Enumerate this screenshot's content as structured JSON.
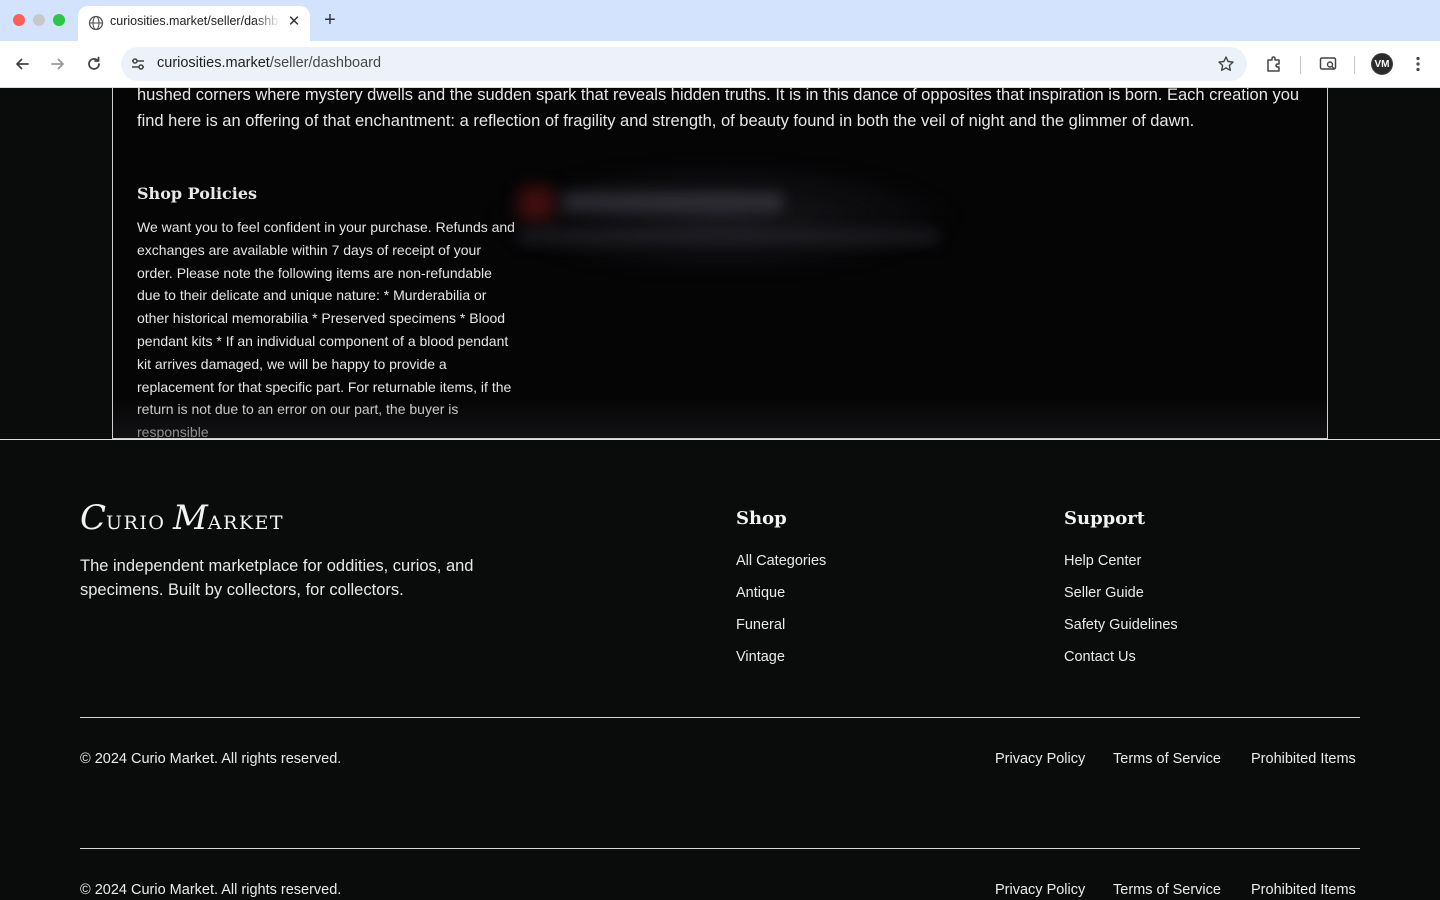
{
  "browser": {
    "tab_title": "curiosities.market/seller/dashboard",
    "url_host": "curiosities.market",
    "url_path": "/seller/dashboard",
    "icons": [
      "globe-icon",
      "close-icon",
      "plus-icon",
      "back-icon",
      "forward-icon",
      "reload-icon",
      "site-info-icon",
      "star-icon",
      "extensions-icon",
      "cast-icon",
      "profile-avatar",
      "menu-icon"
    ],
    "avatar_initials": "VM"
  },
  "shop": {
    "about_text": "hushed corners where mystery dwells and the sudden spark that reveals hidden truths. It is in this dance of opposites that inspiration is born. Each creation you find here is an offering of that enchantment: a reflection of fragility and strength, of beauty found in both the veil of night and the glimmer of dawn.",
    "policies_title": "Shop Policies",
    "policies_text": "We want you to feel confident in your purchase. Refunds and exchanges are available within 7 days of receipt of your order. Please note the following items are non-refundable due to their delicate and unique nature: * Murderabilia or other historical memorabilia * Preserved specimens * Blood pendant kits * If an individual component of a blood pendant kit arrives damaged, we will be happy to provide a replacement for that specific part. For returnable items, if the return is not due to an error on our part, the buyer is responsible"
  },
  "footer": {
    "logo_first_initial": "C",
    "logo_first_rest": "URIO ",
    "logo_second_initial": "M",
    "logo_second_rest": "ARKET",
    "tagline": "The independent marketplace for oddities, curios, and specimens. Built by collectors, for collectors.",
    "shop_title": "Shop",
    "shop_links": [
      "All Categories",
      "Antique",
      "Funeral",
      "Vintage"
    ],
    "support_title": "Support",
    "support_links": [
      "Help Center",
      "Seller Guide",
      "Safety Guidelines",
      "Contact Us"
    ],
    "copyright": "© 2024 Curio Market. All rights reserved.",
    "legal_links": [
      "Privacy Policy",
      "Terms of Service",
      "Prohibited Items"
    ]
  }
}
